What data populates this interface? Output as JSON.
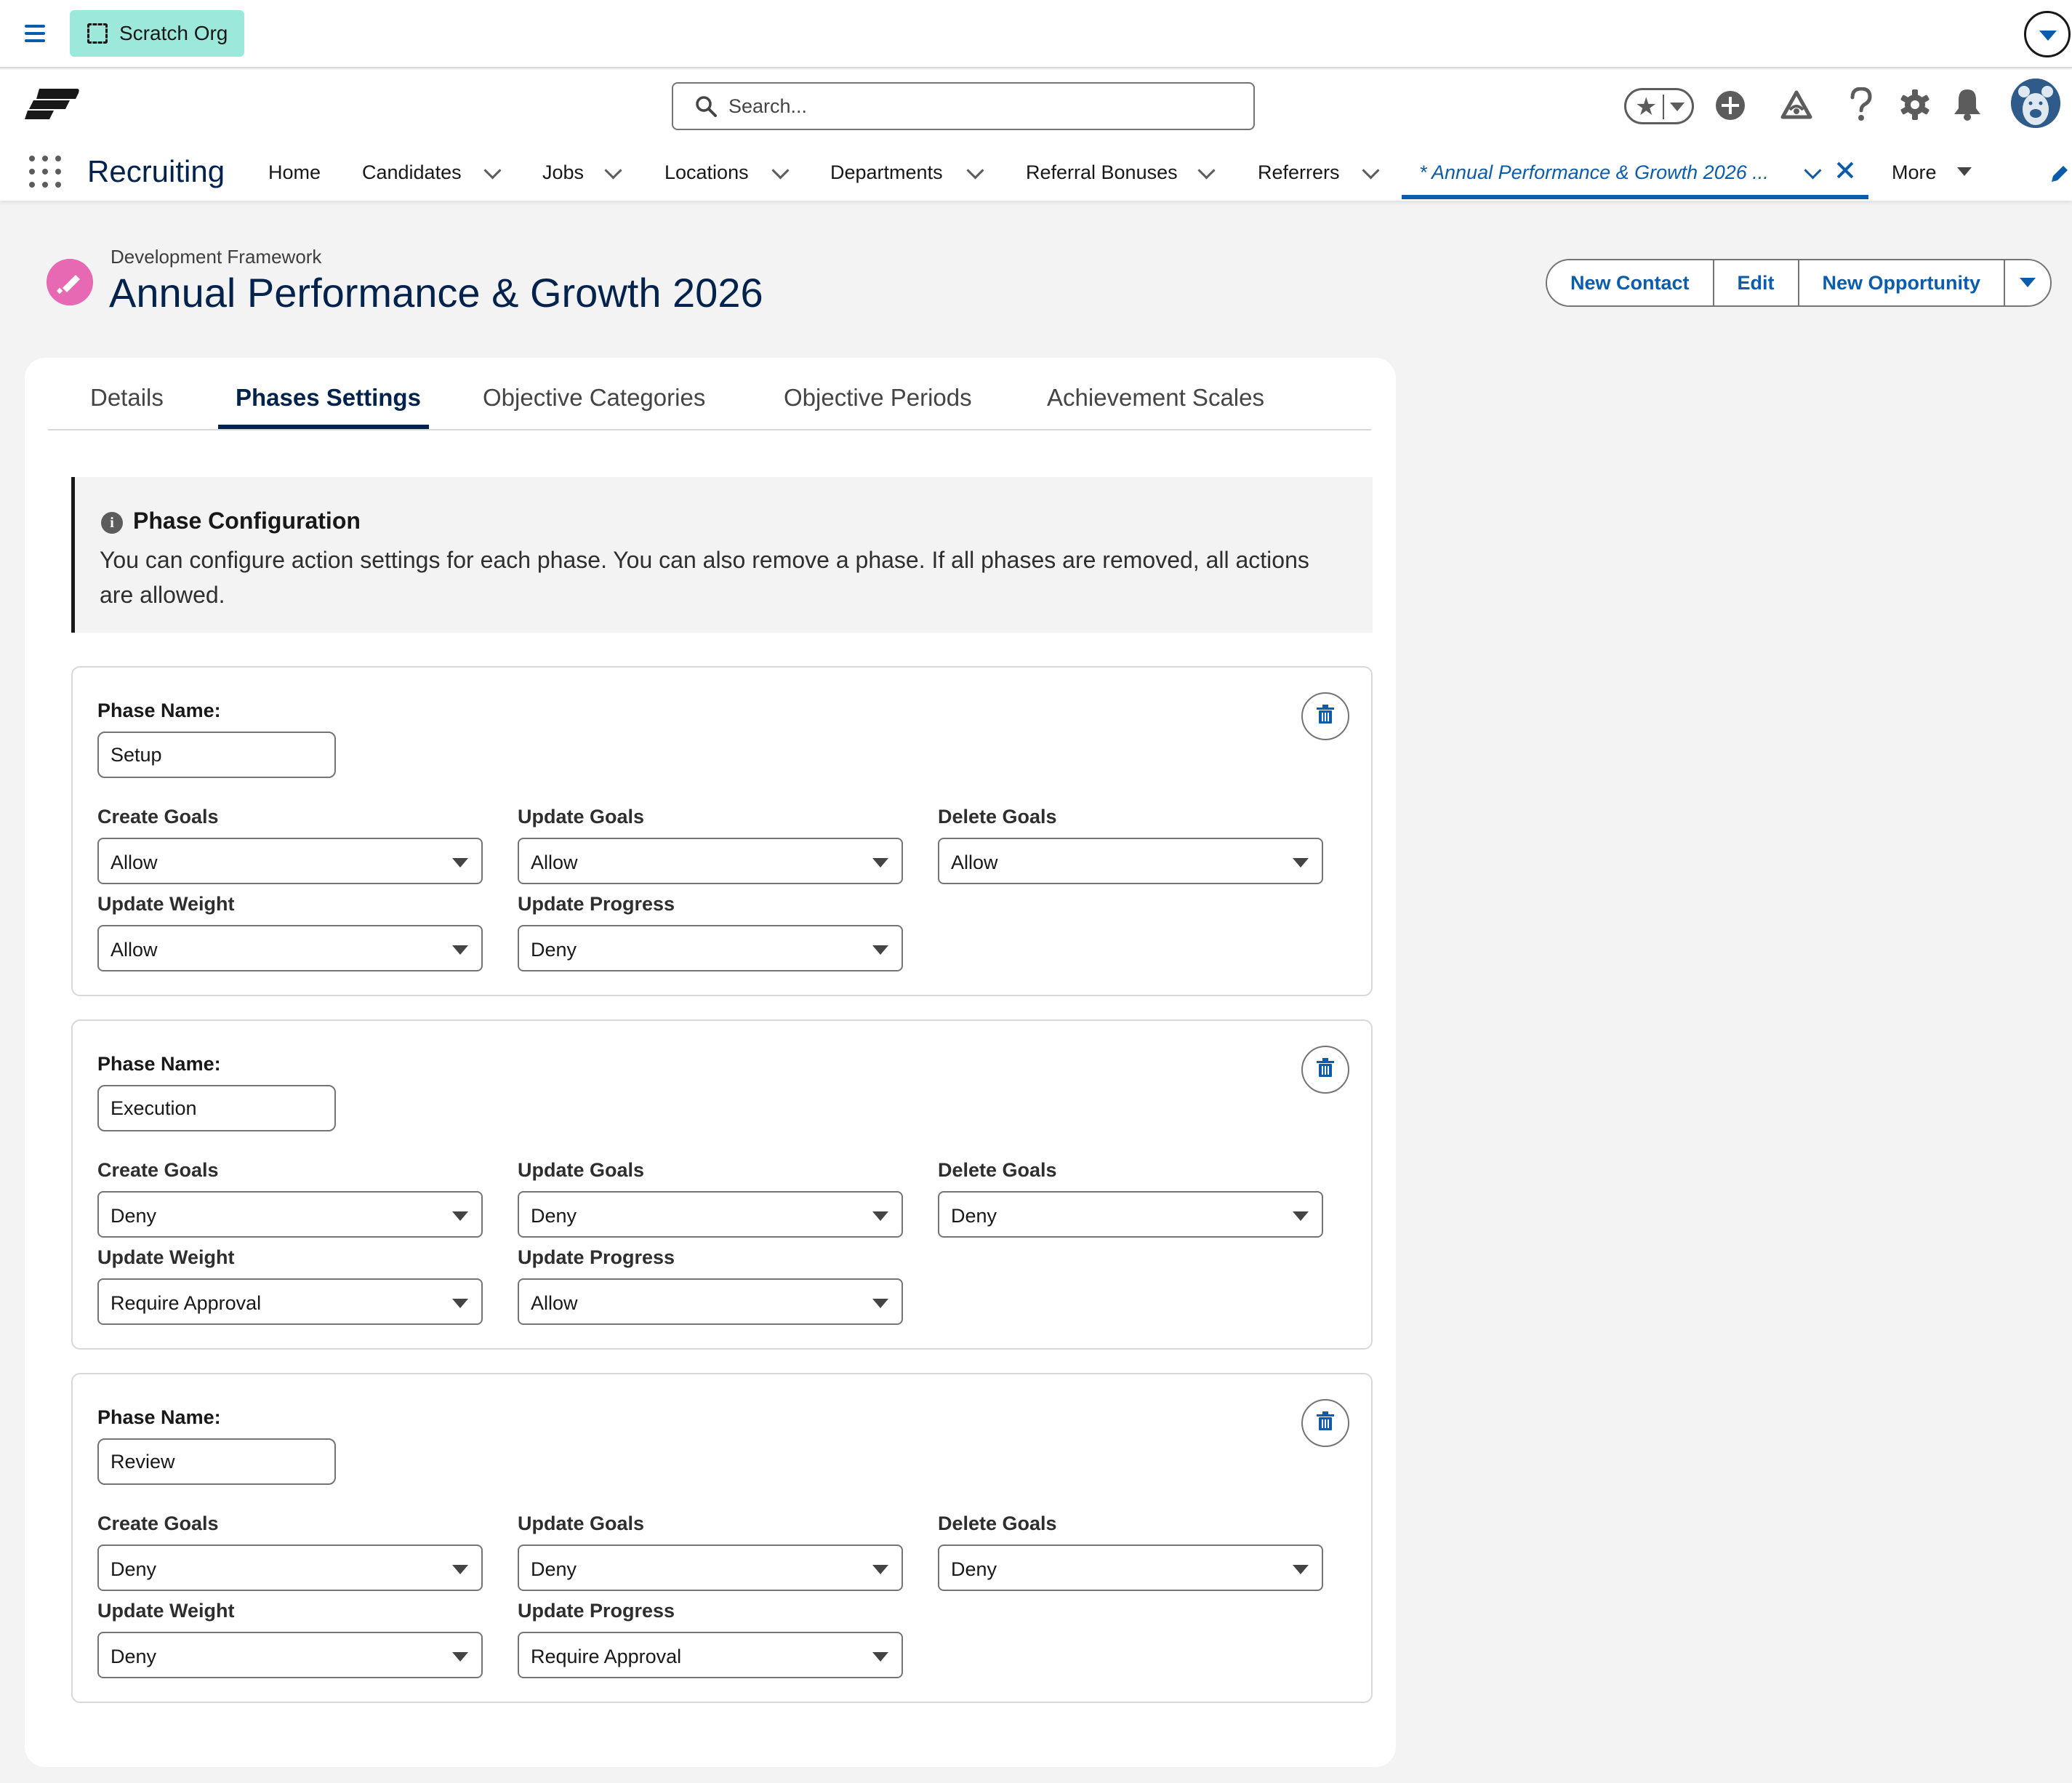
{
  "org": {
    "label": "Scratch Org"
  },
  "header": {
    "search_placeholder": "Search...",
    "app_name": "Recruiting",
    "nav": [
      {
        "label": "Home"
      },
      {
        "label": "Candidates"
      },
      {
        "label": "Jobs"
      },
      {
        "label": "Locations"
      },
      {
        "label": "Departments"
      },
      {
        "label": "Referral Bonuses"
      },
      {
        "label": "Referrers"
      }
    ],
    "active_tab": "* Annual Performance & Growth 2026 ...",
    "more_label": "More",
    "icons": [
      "hamburger-icon",
      "favorites-star-icon",
      "add-icon",
      "trailhead-icon",
      "help-icon",
      "setup-gear-icon",
      "notifications-bell-icon",
      "user-avatar",
      "edit-nav-pencil-icon"
    ]
  },
  "record": {
    "type_label": "Development Framework",
    "title": "Annual Performance & Growth 2026",
    "actions": [
      "New Contact",
      "Edit",
      "New Opportunity"
    ],
    "icon_color": "#e769b4"
  },
  "tabs": [
    {
      "label": "Details"
    },
    {
      "label": "Phases Settings",
      "active": true
    },
    {
      "label": "Objective Categories"
    },
    {
      "label": "Objective Periods"
    },
    {
      "label": "Achievement Scales"
    }
  ],
  "info": {
    "title": "Phase Configuration",
    "body": "You can configure action settings for each phase. You can also remove a phase. If all phases are removed, all actions are allowed."
  },
  "phase_name_label": "Phase Name:",
  "field_labels": {
    "create_goals": "Create Goals",
    "update_goals": "Update Goals",
    "delete_goals": "Delete Goals",
    "update_weight": "Update Weight",
    "update_progress": "Update Progress"
  },
  "phases": [
    {
      "name": "Setup",
      "create_goals": "Allow",
      "update_goals": "Allow",
      "delete_goals": "Allow",
      "update_weight": "Allow",
      "update_progress": "Deny"
    },
    {
      "name": "Execution",
      "create_goals": "Deny",
      "update_goals": "Deny",
      "delete_goals": "Deny",
      "update_weight": "Require Approval",
      "update_progress": "Allow"
    },
    {
      "name": "Review",
      "create_goals": "Deny",
      "update_goals": "Deny",
      "delete_goals": "Deny",
      "update_weight": "Deny",
      "update_progress": "Require Approval"
    }
  ],
  "colors": {
    "brand": "#0b5cab",
    "title": "#03234d",
    "org_pill": "#9ce8db"
  }
}
